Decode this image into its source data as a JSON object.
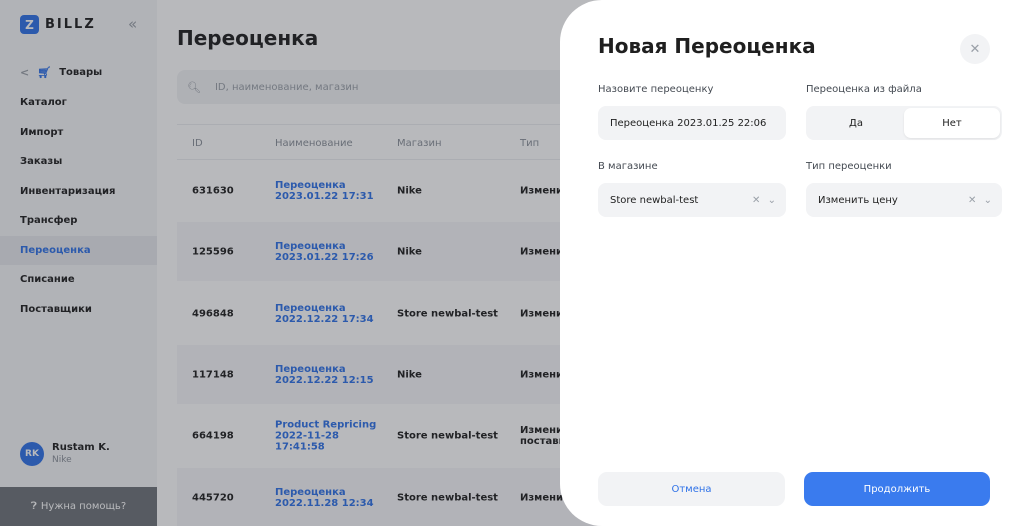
{
  "sidebar": {
    "logo_letter": "Z",
    "logo_text": "BILLZ",
    "collapse_icon": "«",
    "back_label": "Товары",
    "items": [
      {
        "label": "Каталог"
      },
      {
        "label": "Импорт"
      },
      {
        "label": "Заказы"
      },
      {
        "label": "Инвентаризация"
      },
      {
        "label": "Трансфер"
      },
      {
        "label": "Переоценка"
      },
      {
        "label": "Списание"
      },
      {
        "label": "Поставщики"
      }
    ],
    "active_item": "Переоценка",
    "user": {
      "initials": "RK",
      "name": "Rustam K.",
      "store": "Nike"
    },
    "help_label": "Нужна помощь?"
  },
  "main": {
    "title": "Переоценка",
    "search_placeholder": "ID, наименование, магазин",
    "columns": {
      "id": "ID",
      "name": "Наименование",
      "store": "Магазин",
      "type": "Тип"
    },
    "rows": [
      {
        "id": "631630",
        "name": "Переоценка 2023.01.22 17:31",
        "store": "Nike",
        "type": "Изменит"
      },
      {
        "id": "125596",
        "name": "Переоценка 2023.01.22 17:26",
        "store": "Nike",
        "type": "Изменит"
      },
      {
        "id": "496848",
        "name": "Переоценка 2022.12.22 17:34",
        "store": "Store newbal-test",
        "type": "Изменит"
      },
      {
        "id": "117148",
        "name": "Переоценка 2022.12.22 12:15",
        "store": "Nike",
        "type": "Изменит"
      },
      {
        "id": "664198",
        "name": "Product Repricing 2022-11-28 17:41:58",
        "store": "Store newbal-test",
        "type": "Изменит поставк"
      },
      {
        "id": "445720",
        "name": "Переоценка 2022.11.28 12:34",
        "store": "Store newbal-test",
        "type": "Изменит"
      }
    ]
  },
  "modal": {
    "title": "Новая Переоценка",
    "name_label": "Назовите переоценку",
    "name_value": "Переоценка 2023.01.25 22:06",
    "file_label": "Переоценка из файла",
    "file_options": [
      "Да",
      "Нет"
    ],
    "file_selected": "Нет",
    "store_label": "В магазине",
    "store_value": "Store newbal-test",
    "type_label": "Тип переоценки",
    "type_value": "Изменить цену",
    "cancel_label": "Отмена",
    "continue_label": "Продолжить"
  },
  "colors": {
    "accent": "#2f72e8",
    "primary_button": "#3a7bee",
    "overlay": "rgba(40,44,52,0.33)"
  }
}
